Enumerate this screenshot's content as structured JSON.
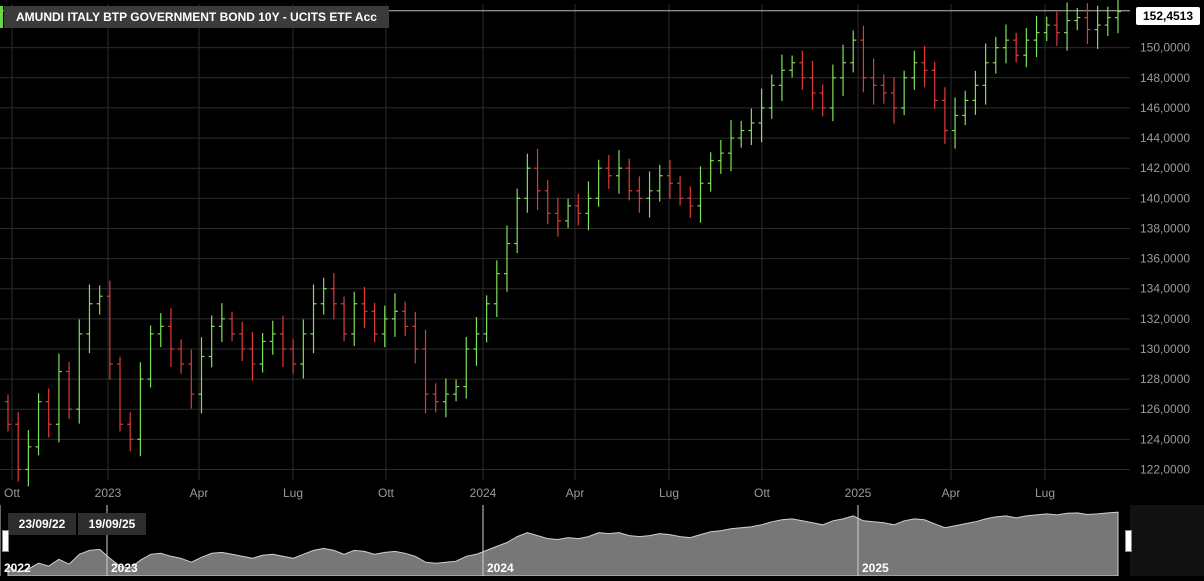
{
  "title": "AMUNDI ITALY BTP GOVERNMENT BOND 10Y - UCITS ETF Acc",
  "last_price": "152,4513",
  "range": {
    "start": "23/09/22",
    "end": "19/09/25"
  },
  "colors": {
    "up": "#7ee05a",
    "down": "#e03a3a",
    "grid": "#2c2c2c",
    "axis_text": "#9a9a9a",
    "nav_fill": "#8c8c8c"
  },
  "icons": {
    "left_handle": "drag-handle-icon",
    "right_handle": "drag-handle-icon"
  },
  "chart_data": {
    "type": "ohlc",
    "interval": "weekly",
    "y_ticks": [
      "122,0000",
      "124,0000",
      "126,0000",
      "128,0000",
      "130,0000",
      "132,0000",
      "134,0000",
      "136,0000",
      "138,0000",
      "140,0000",
      "142,0000",
      "144,0000",
      "146,0000",
      "148,0000",
      "150,0000"
    ],
    "ylim": [
      121.3,
      152.9
    ],
    "x_ticks": [
      "Ott",
      "2023",
      "Apr",
      "Lug",
      "Ott",
      "2024",
      "Apr",
      "Lug",
      "Ott",
      "2025",
      "Apr",
      "Lug"
    ],
    "navigator_labels": [
      "2022",
      "2023",
      "2024",
      "2025"
    ],
    "grid": true,
    "closes": [
      125.0,
      122.0,
      123.5,
      126.5,
      125.0,
      128.5,
      126.0,
      131.0,
      133.0,
      133.5,
      129.0,
      125.0,
      124.0,
      128.0,
      131.0,
      131.5,
      130.0,
      129.0,
      127.0,
      129.5,
      131.5,
      132.0,
      131.0,
      130.0,
      129.0,
      130.5,
      131.0,
      130.0,
      129.0,
      131.0,
      133.0,
      134.0,
      133.0,
      131.0,
      133.0,
      132.5,
      131.0,
      132.0,
      132.5,
      131.5,
      130.0,
      127.0,
      126.5,
      127.0,
      127.5,
      130.0,
      131.0,
      133.0,
      135.0,
      137.0,
      140.0,
      142.0,
      140.5,
      139.0,
      138.5,
      139.5,
      139.0,
      140.0,
      142.0,
      141.5,
      142.0,
      140.5,
      140.0,
      140.5,
      141.5,
      141.0,
      140.0,
      139.5,
      141.0,
      142.5,
      143.0,
      144.0,
      144.5,
      145.0,
      146.0,
      147.5,
      148.5,
      149.0,
      148.0,
      147.0,
      146.0,
      148.0,
      149.0,
      150.5,
      148.0,
      147.5,
      147.0,
      146.0,
      148.0,
      149.0,
      148.5,
      146.5,
      144.5,
      145.5,
      146.5,
      147.5,
      149.0,
      150.0,
      150.5,
      149.5,
      150.5,
      151.0,
      151.5,
      151.0,
      151.8,
      152.0,
      151.2,
      151.5,
      152.0,
      152.4
    ]
  }
}
